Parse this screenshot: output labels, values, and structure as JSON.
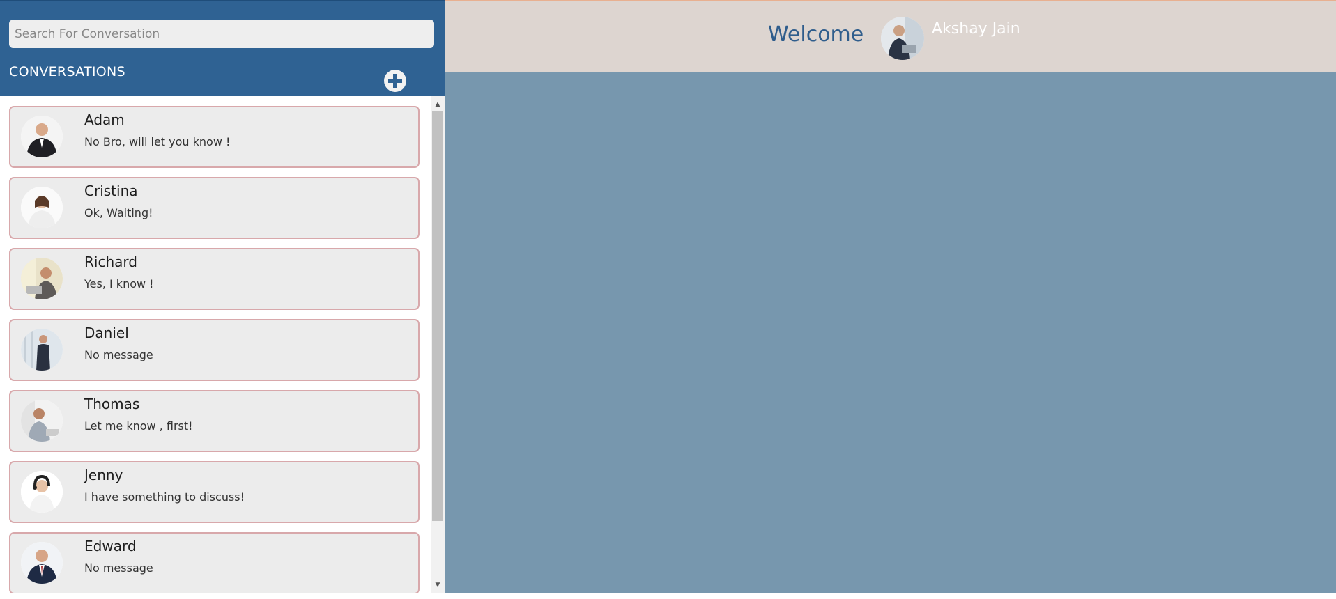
{
  "search": {
    "placeholder": "Search For Conversation"
  },
  "sidebar": {
    "title": "CONVERSATIONS",
    "add_icon": "plus-circle-icon",
    "conversations": [
      {
        "name": "Adam",
        "message": "No Bro, will let you know !"
      },
      {
        "name": "Cristina",
        "message": "Ok, Waiting!"
      },
      {
        "name": "Richard",
        "message": "Yes, I know !"
      },
      {
        "name": "Daniel",
        "message": "No message"
      },
      {
        "name": "Thomas",
        "message": "Let me know , first!"
      },
      {
        "name": "Jenny",
        "message": "I have something to discuss!"
      },
      {
        "name": "Edward",
        "message": "No message"
      }
    ]
  },
  "header": {
    "welcome": "Welcome",
    "user_name": "Akshay Jain"
  },
  "colors": {
    "sidebar_header": "#2f6293",
    "main_background": "#7797ae",
    "topbar": "#ddd5d0",
    "item_border": "#d8a8ab"
  }
}
